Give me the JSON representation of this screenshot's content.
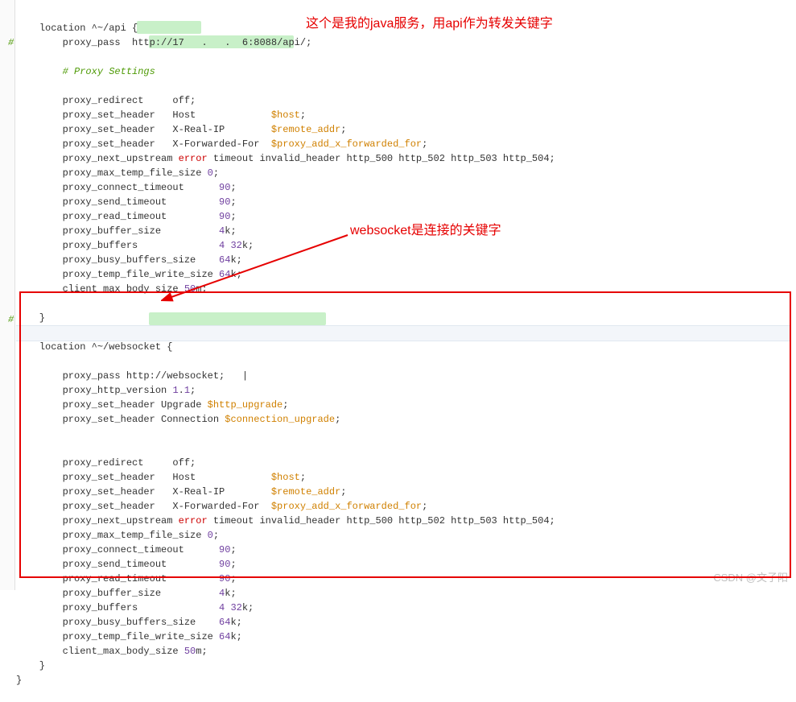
{
  "anno1": "这个是我的java服务，用api作为转发关键字",
  "anno2": "websocket是连接的关键字",
  "watermark": "CSDN @文子阳",
  "b1": {
    "loc": "location ^~/api {",
    "pass1": "        proxy_pass  http://17",
    "ip_blur": "   .   .  6",
    "pass2": ":8088/api/;",
    "comment": "        # Proxy Settings",
    "redir": "        proxy_redirect     off;",
    "h_host_a": "        proxy_set_header   Host             ",
    "h_host_v": "$host",
    "h_realip_a": "        proxy_set_header   X-Real-IP        ",
    "h_realip_v": "$remote_addr",
    "h_fwd_a": "        proxy_set_header   X-Forwarded-For  ",
    "h_fwd_v": "$proxy_add_x_forwarded_for",
    "next_a": "        proxy_next_upstream ",
    "next_err": "error",
    "next_b": " timeout invalid_header http_500 http_502 http_503 http_504;",
    "maxtemp_a": "        proxy_max_temp_file_size ",
    "maxtemp_n": "0",
    "connto_a": "        proxy_connect_timeout      ",
    "connto_n": "90",
    "sendto_a": "        proxy_send_timeout         ",
    "sendto_n": "90",
    "readto_a": "        proxy_read_timeout         ",
    "readto_n": "90",
    "bufsz_a": "        proxy_buffer_size          ",
    "bufsz_n": "4",
    "bufsz_b": "k;",
    "bufs_a": "        proxy_buffers              ",
    "bufs_n1": "4",
    "bufs_n2": "32",
    "busy_a": "        proxy_busy_buffers_size    ",
    "busy_n": "64",
    "tempw_a": "        proxy_temp_file_write_size ",
    "tempw_n": "64",
    "cmax_a": "        client_max_body_size ",
    "cmax_n": "50",
    "cmax_b": "m;",
    "close": "    }"
  },
  "b2": {
    "loc": "location ^~/websocket {",
    "pass": "        proxy_pass http://websocket;",
    "http11_a": "        proxy_http_version ",
    "http11_n1": "1",
    "http11_n2": "1",
    "up_a": "        proxy_set_header Upgrade ",
    "up_v": "$http_upgrade",
    "conn_a": "        proxy_set_header Connection ",
    "conn_v": "$connection_upgrade",
    "redir": "        proxy_redirect     off;",
    "h_host_a": "        proxy_set_header   Host             ",
    "h_host_v": "$host",
    "h_realip_a": "        proxy_set_header   X-Real-IP        ",
    "h_realip_v": "$remote_addr",
    "h_fwd_a": "        proxy_set_header   X-Forwarded-For  ",
    "h_fwd_v": "$proxy_add_x_forwarded_for",
    "next_a": "        proxy_next_upstream ",
    "next_err": "error",
    "next_b": " timeout invalid_header http_500 http_502 http_503 http_504;",
    "maxtemp_a": "        proxy_max_temp_file_size ",
    "maxtemp_n": "0",
    "connto_a": "        proxy_connect_timeout      ",
    "connto_n": "90",
    "sendto_a": "        proxy_send_timeout         ",
    "sendto_n": "90",
    "readto_a": "        proxy_read_timeout         ",
    "readto_n": "90",
    "bufsz_a": "        proxy_buffer_size          ",
    "bufsz_n": "4",
    "bufsz_b": "k;",
    "bufs_a": "        proxy_buffers              ",
    "bufs_n1": "4",
    "bufs_n2": "32",
    "busy_a": "        proxy_busy_buffers_size    ",
    "busy_n": "64",
    "tempw_a": "        proxy_temp_file_write_size ",
    "tempw_n": "64",
    "cmax_a": "        client_max_body_size ",
    "cmax_n": "50",
    "cmax_b": "m;",
    "close": "    }",
    "brace": "}"
  }
}
